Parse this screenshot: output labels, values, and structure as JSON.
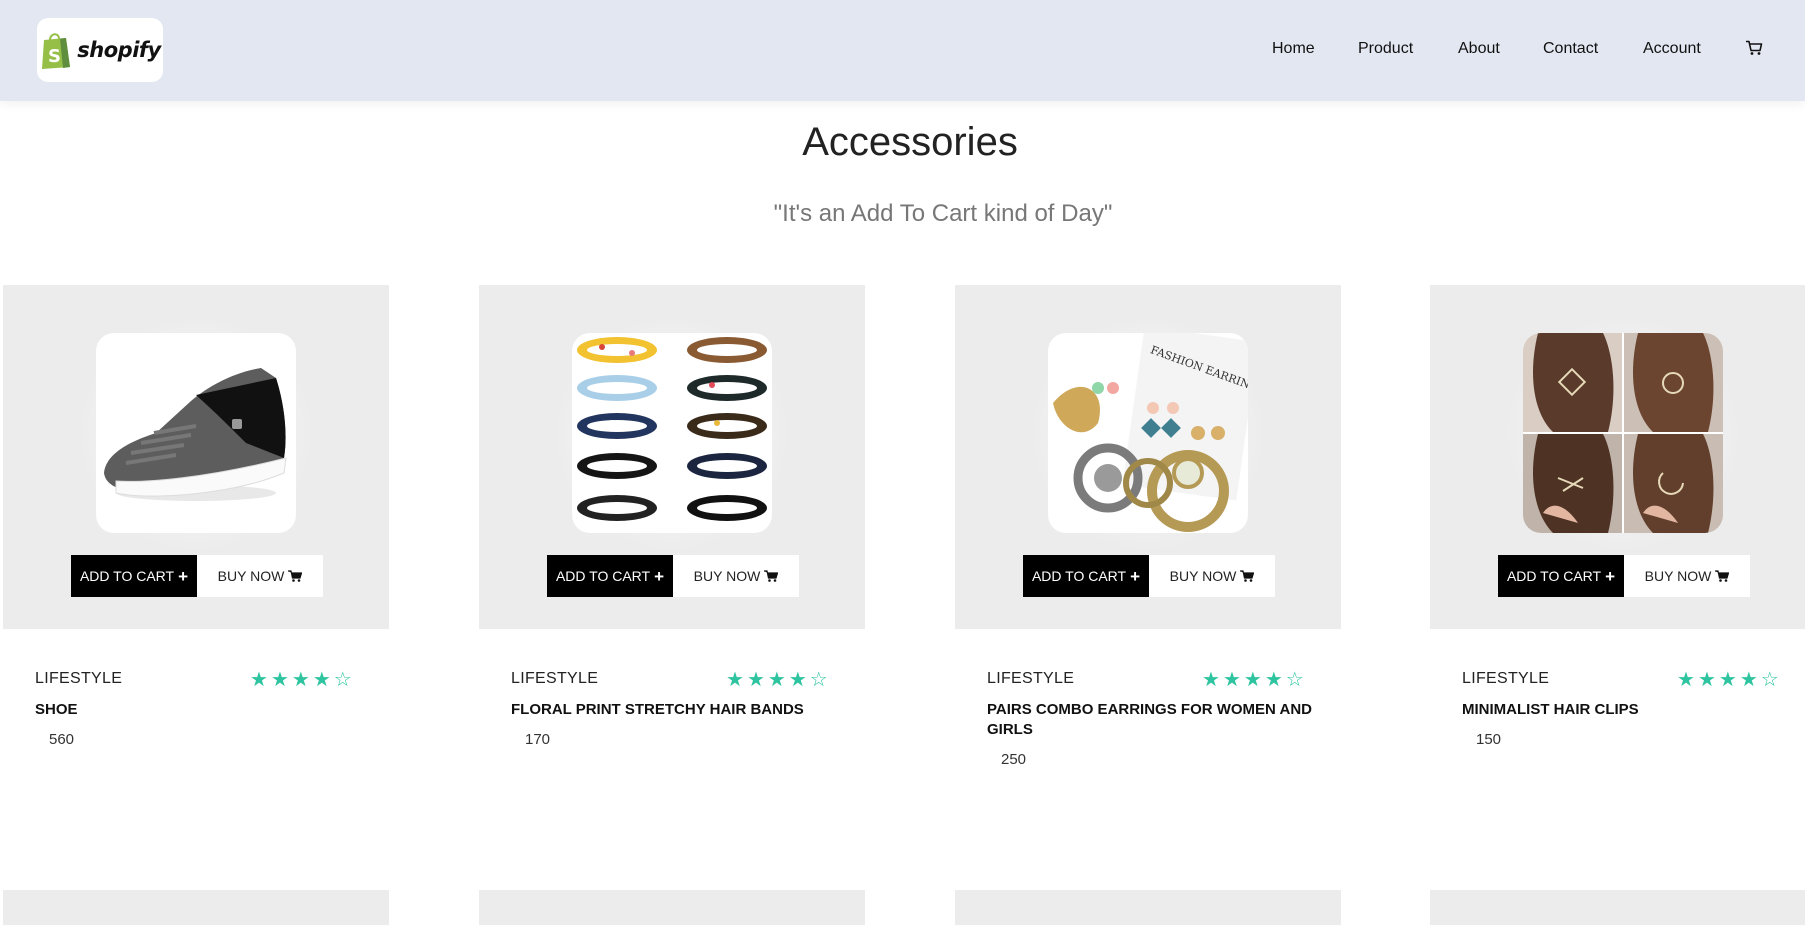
{
  "header": {
    "logo_text": "shopify",
    "nav": [
      "Home",
      "Product",
      "About",
      "Contact",
      "Account"
    ],
    "cart_icon": "cart-icon"
  },
  "page": {
    "title": "Accessories",
    "subtitle": "\"It's an Add To Cart kind of Day\""
  },
  "buttons": {
    "add_to_cart": "ADD TO CART",
    "buy_now": "BUY NOW"
  },
  "products": [
    {
      "category": "LIFESTYLE",
      "name": "SHOE",
      "price": "560",
      "rating": 4,
      "max_rating": 5,
      "image": "shoe-image"
    },
    {
      "category": "LIFESTYLE",
      "name": "FLORAL PRINT STRETCHY HAIR BANDS",
      "price": "170",
      "rating": 4,
      "max_rating": 5,
      "image": "hair-bands-image"
    },
    {
      "category": "LIFESTYLE",
      "name": "PAIRS COMBO EARRINGS FOR WOMEN AND GIRLS",
      "price": "250",
      "rating": 4,
      "max_rating": 5,
      "image": "earrings-image"
    },
    {
      "category": "LIFESTYLE",
      "name": "MINIMALIST HAIR CLIPS",
      "price": "150",
      "rating": 4,
      "max_rating": 5,
      "image": "hair-clips-image"
    }
  ],
  "colors": {
    "header_bg": "#e3e7f2",
    "card_bg": "#ececec",
    "star": "#2ec4a0",
    "logo_green": "#95bf47"
  }
}
